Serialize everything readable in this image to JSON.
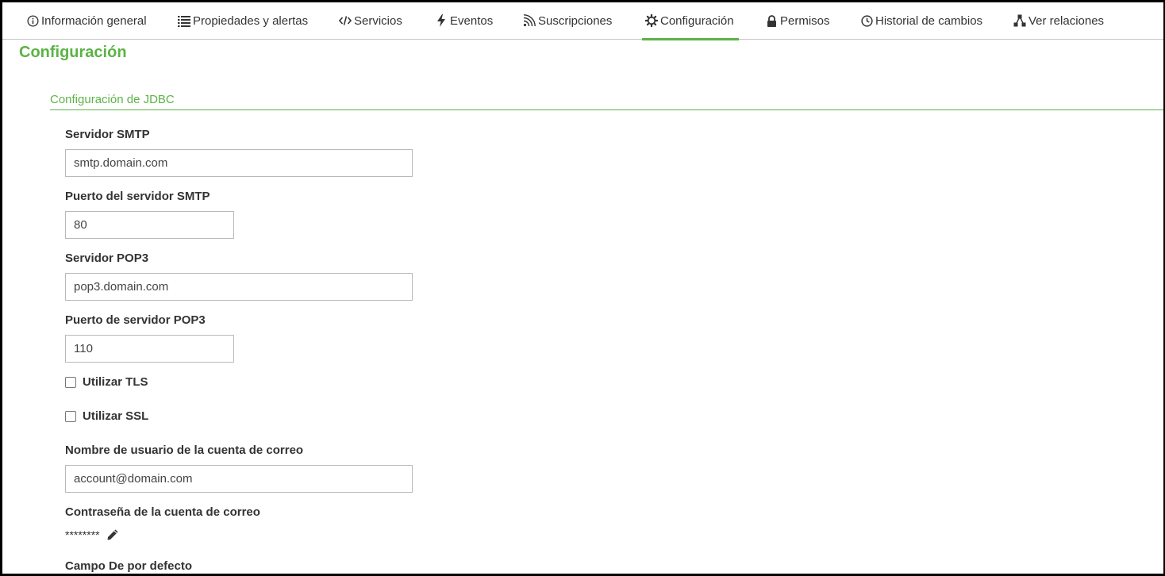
{
  "tabs": [
    {
      "label": "Información general",
      "icon": "info-icon"
    },
    {
      "label": "Propiedades y alertas",
      "icon": "list-icon"
    },
    {
      "label": "Servicios",
      "icon": "code-icon"
    },
    {
      "label": "Eventos",
      "icon": "bolt-icon"
    },
    {
      "label": "Suscripciones",
      "icon": "feed-icon"
    },
    {
      "label": "Configuración",
      "icon": "gear-icon",
      "active": true
    },
    {
      "label": "Permisos",
      "icon": "lock-icon"
    },
    {
      "label": "Historial de cambios",
      "icon": "clock-icon"
    },
    {
      "label": "Ver relaciones",
      "icon": "network-icon"
    }
  ],
  "page": {
    "title": "Configuración"
  },
  "section": {
    "title": "Configuración de JDBC"
  },
  "form": {
    "smtp_server": {
      "label": "Servidor SMTP",
      "value": "smtp.domain.com"
    },
    "smtp_port": {
      "label": "Puerto del servidor SMTP",
      "value": "80"
    },
    "pop3_server": {
      "label": "Servidor POP3",
      "value": "pop3.domain.com"
    },
    "pop3_port": {
      "label": "Puerto de servidor POP3",
      "value": "110"
    },
    "use_tls": {
      "label": "Utilizar TLS",
      "checked": false
    },
    "use_ssl": {
      "label": "Utilizar SSL",
      "checked": false
    },
    "mail_user": {
      "label": "Nombre de usuario de la cuenta de correo",
      "value": "account@domain.com"
    },
    "mail_password": {
      "label": "Contraseña de la cuenta de correo",
      "masked": "********"
    },
    "default_from": {
      "label": "Campo De por defecto"
    }
  },
  "colors": {
    "accent": "#5bb345",
    "text": "#333333",
    "border": "#b9b9b9"
  }
}
